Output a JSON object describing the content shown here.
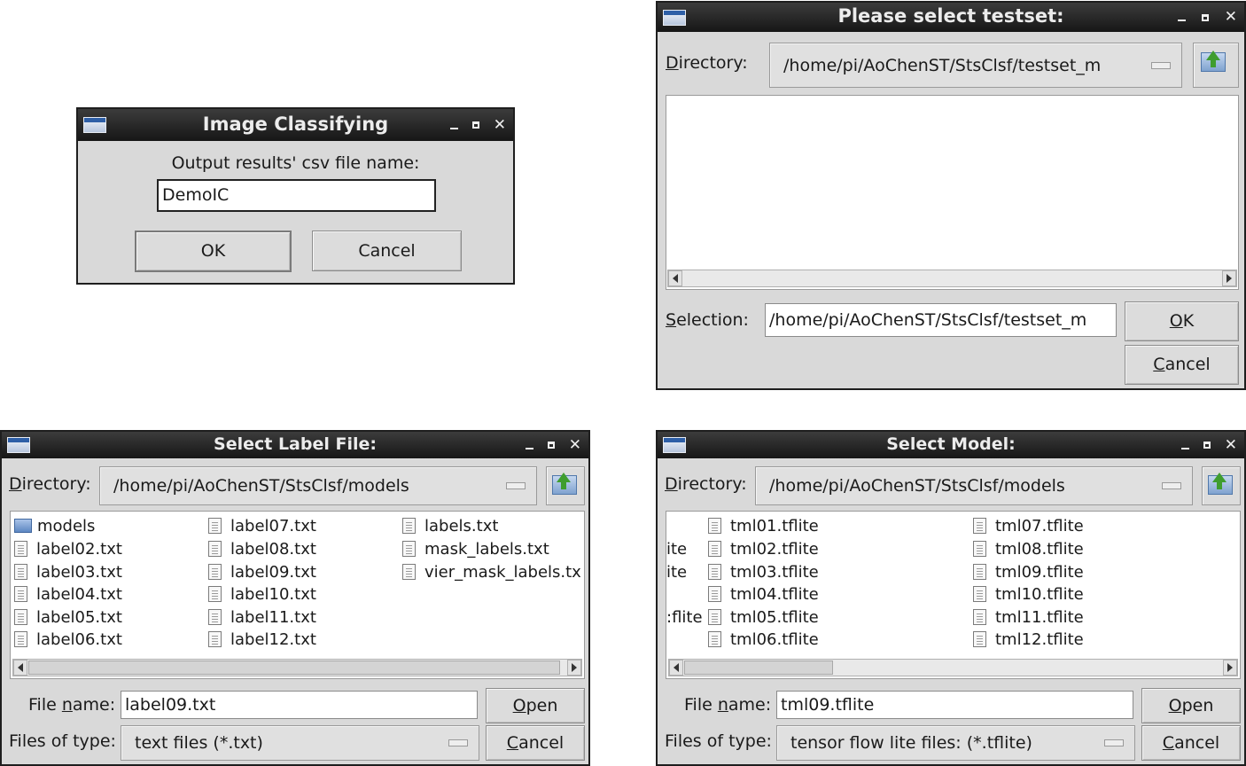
{
  "image_classifying": {
    "title": "Image Classifying",
    "prompt": "Output results' csv file name:",
    "input_value": "DemoIC",
    "ok_label": "OK",
    "cancel_label": "Cancel"
  },
  "testset_dialog": {
    "title": "Please select testset:",
    "directory_label_u": "D",
    "directory_label_rest": "irectory:",
    "directory_value": "/home/pi/AoChenST/StsClsf/testset_m",
    "selection_label_u": "S",
    "selection_label_rest": "election:",
    "selection_value": "/home/pi/AoChenST/StsClsf/testset_m",
    "ok_label_u": "O",
    "ok_label_rest": "K",
    "cancel_label_u": "C",
    "cancel_label_rest": "ancel"
  },
  "label_dialog": {
    "title": "Select Label File:",
    "directory_label_u": "D",
    "directory_label_rest": "irectory:",
    "directory_value": "/home/pi/AoChenST/StsClsf/models",
    "columns": [
      [
        "models",
        "label02.txt",
        "label03.txt",
        "label04.txt",
        "label05.txt",
        "label06.txt"
      ],
      [
        "label07.txt",
        "label08.txt",
        "label09.txt",
        "label10.txt",
        "label11.txt",
        "label12.txt"
      ],
      [
        "labels.txt",
        "mask_labels.txt",
        "vier_mask_labels.tx"
      ]
    ],
    "filename_label_pre": "File ",
    "filename_label_u": "n",
    "filename_label_rest": "ame:",
    "filename_value": "label09.txt",
    "filetype_label": "Files of type:",
    "filetype_value": "text files (*.txt)",
    "open_label_u": "O",
    "open_label_rest": "pen",
    "cancel_label_u": "C",
    "cancel_label_rest": "ancel"
  },
  "model_dialog": {
    "title": "Select Model:",
    "directory_label_u": "D",
    "directory_label_rest": "irectory:",
    "directory_value": "/home/pi/AoChenST/StsClsf/models",
    "partial_column": [
      "ite",
      "ite",
      ":flite"
    ],
    "columns": [
      [
        "tml01.tflite",
        "tml02.tflite",
        "tml03.tflite",
        "tml04.tflite",
        "tml05.tflite",
        "tml06.tflite"
      ],
      [
        "tml07.tflite",
        "tml08.tflite",
        "tml09.tflite",
        "tml10.tflite",
        "tml11.tflite",
        "tml12.tflite"
      ]
    ],
    "filename_label_pre": "File ",
    "filename_label_u": "n",
    "filename_label_rest": "ame:",
    "filename_value": "tml09.tflite",
    "filetype_label": "Files of type:",
    "filetype_value": "tensor flow lite files: (*.tflite)",
    "open_label_u": "O",
    "open_label_rest": "pen",
    "cancel_label_u": "C",
    "cancel_label_rest": "ancel"
  }
}
